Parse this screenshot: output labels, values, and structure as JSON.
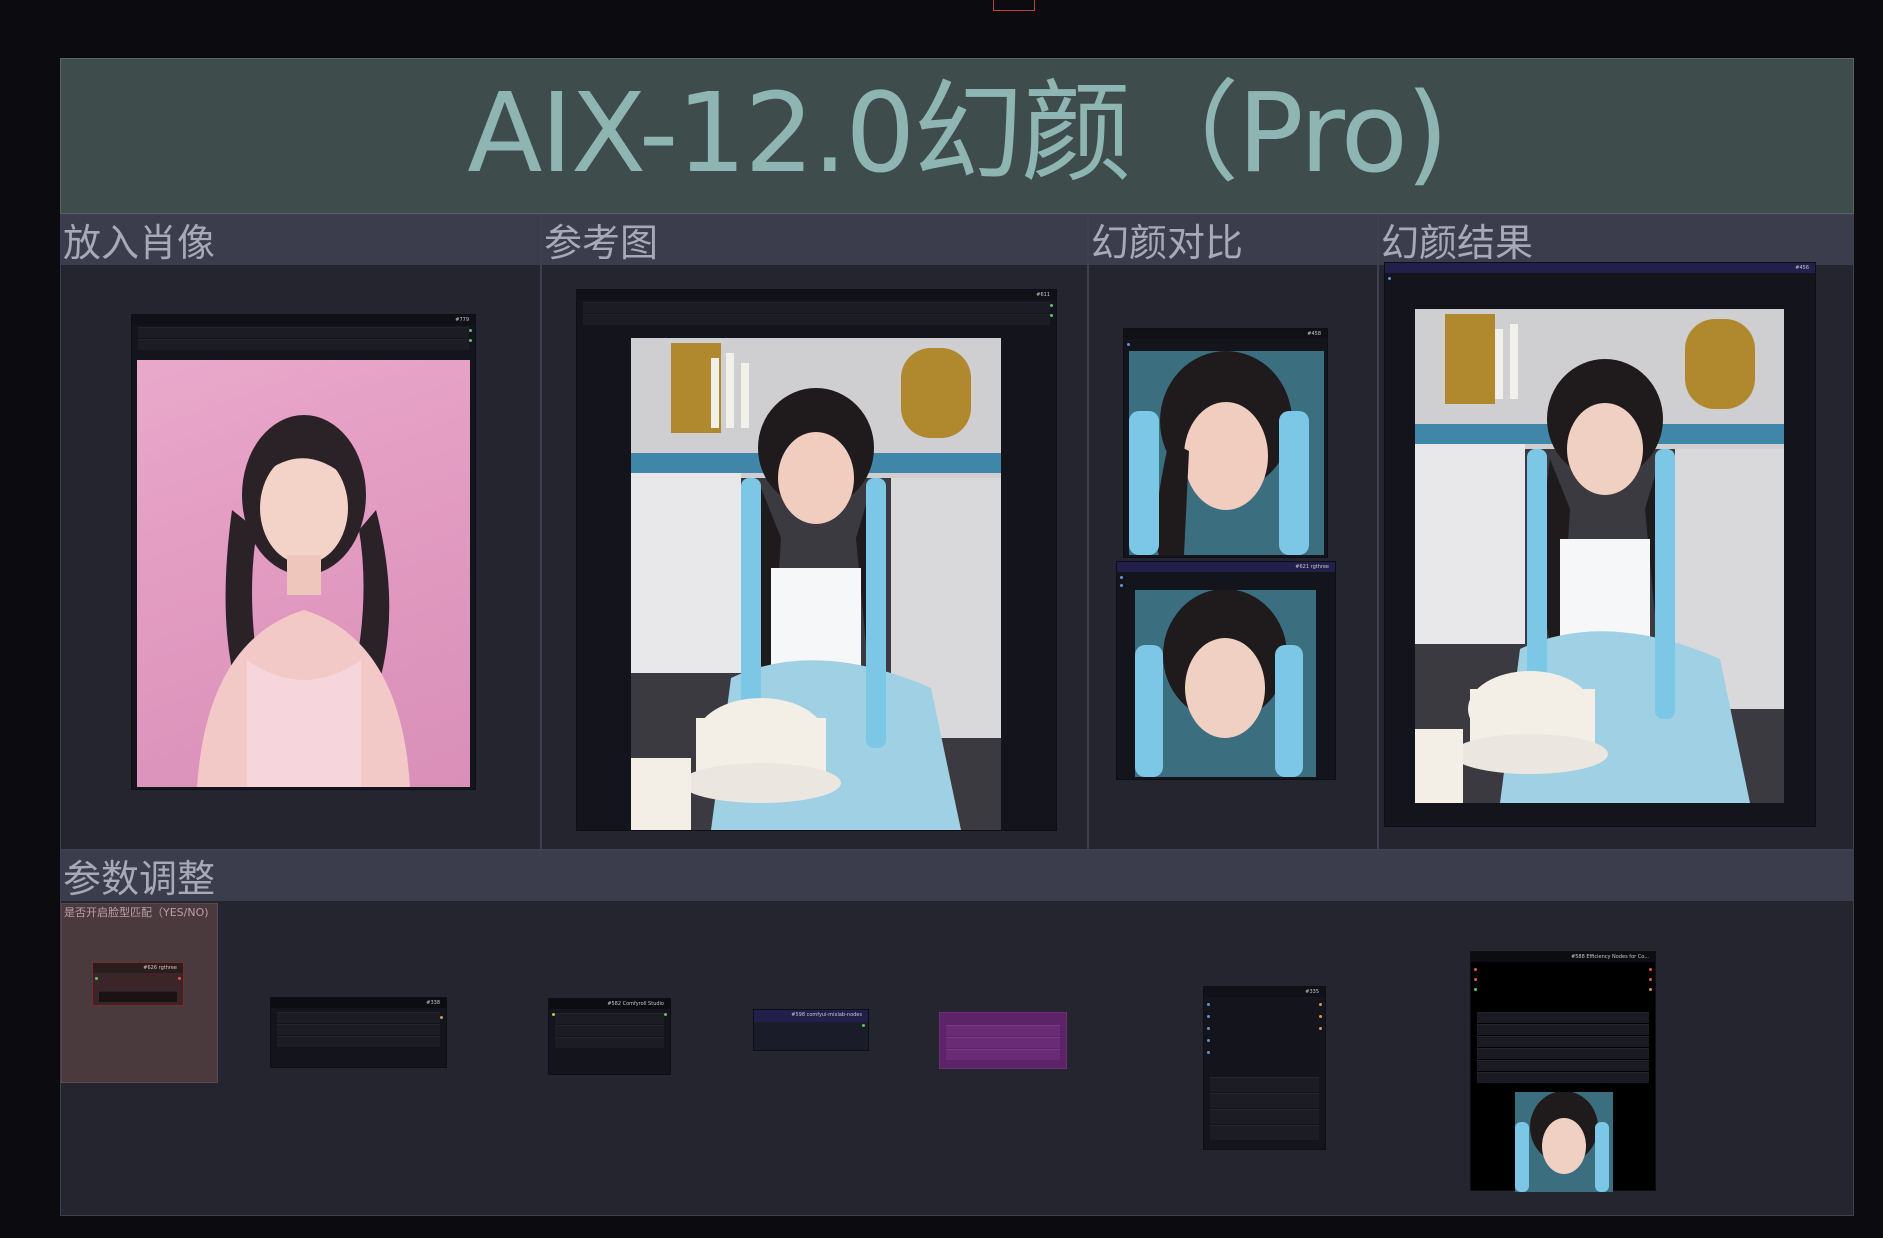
{
  "app": {
    "title": "AIX-12.0幻颜（Pro)"
  },
  "groups": {
    "portrait": {
      "title": "放入肖像",
      "node_id": "#779"
    },
    "reference": {
      "title": "参考图",
      "node_id": "#611"
    },
    "compare": {
      "title": "幻颜对比",
      "node_top_id": "#458",
      "node_bottom_id": "#621 rgthree"
    },
    "result": {
      "title": "幻颜结果",
      "node_id": "#456"
    },
    "params": {
      "title": "参数调整",
      "face_match_label": "是否开启脸型匹配（YES/NO)"
    }
  },
  "param_nodes": [
    {
      "id": "#626 rgthree"
    },
    {
      "id": "#338"
    },
    {
      "id": "#582 Comfyroll Studio"
    },
    {
      "id": "#598 comfyui-mixlab-nodes"
    },
    {
      "id": "#588 Efficiency Nodes for Co..."
    },
    {
      "id": "#335"
    }
  ],
  "colors": {
    "background": "#0b0b10",
    "banner": "#3e4d4c",
    "banner_text": "#8fb5b2",
    "group_bg": "#25252f",
    "group_head": "#3b3c4c",
    "group_text": "#a7a8b8",
    "accent_purple": "#5c2466",
    "accent_navy": "#22204a",
    "accent_maroon": "#3a2628"
  }
}
